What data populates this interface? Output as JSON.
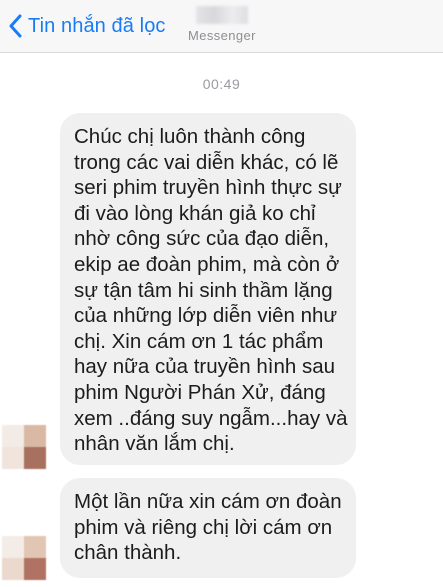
{
  "header": {
    "back_label": "Tin nhắn đã lọc",
    "subtitle": "Messenger"
  },
  "conversation": {
    "timestamp": "00:49",
    "messages": [
      {
        "lines": [
          "Chúc chị luôn thành công",
          "trong các vai diễn khác, có lẽ",
          "seri phim truyền hình thực sự",
          "đi vào lòng khán giả ko chỉ",
          "nhờ công sức của đạo diễn,",
          "ekip ae đoàn phim, mà còn ở",
          "sự tận tâm hi sinh thầm lặng",
          "của những lớp diễn viên như",
          "chị. Xin cám ơn 1 tác phẩm",
          "hay nữa của truyền hình sau",
          "phim Người Phán Xử, đáng",
          "xem ..đáng suy ngẫm...hay và",
          "nhân văn lắm chị."
        ]
      },
      {
        "lines": [
          "Một lần nữa xin cám ơn đoàn",
          "phim và riêng chị lời cám ơn",
          "chân thành."
        ]
      }
    ]
  },
  "colors": {
    "accent": "#1a7cf5",
    "bubble_bg": "#f1f0f0",
    "nav_bg": "#f7f7f8",
    "timestamp": "#9a9aa0"
  },
  "icons": {
    "back": "chevron-left-icon"
  }
}
